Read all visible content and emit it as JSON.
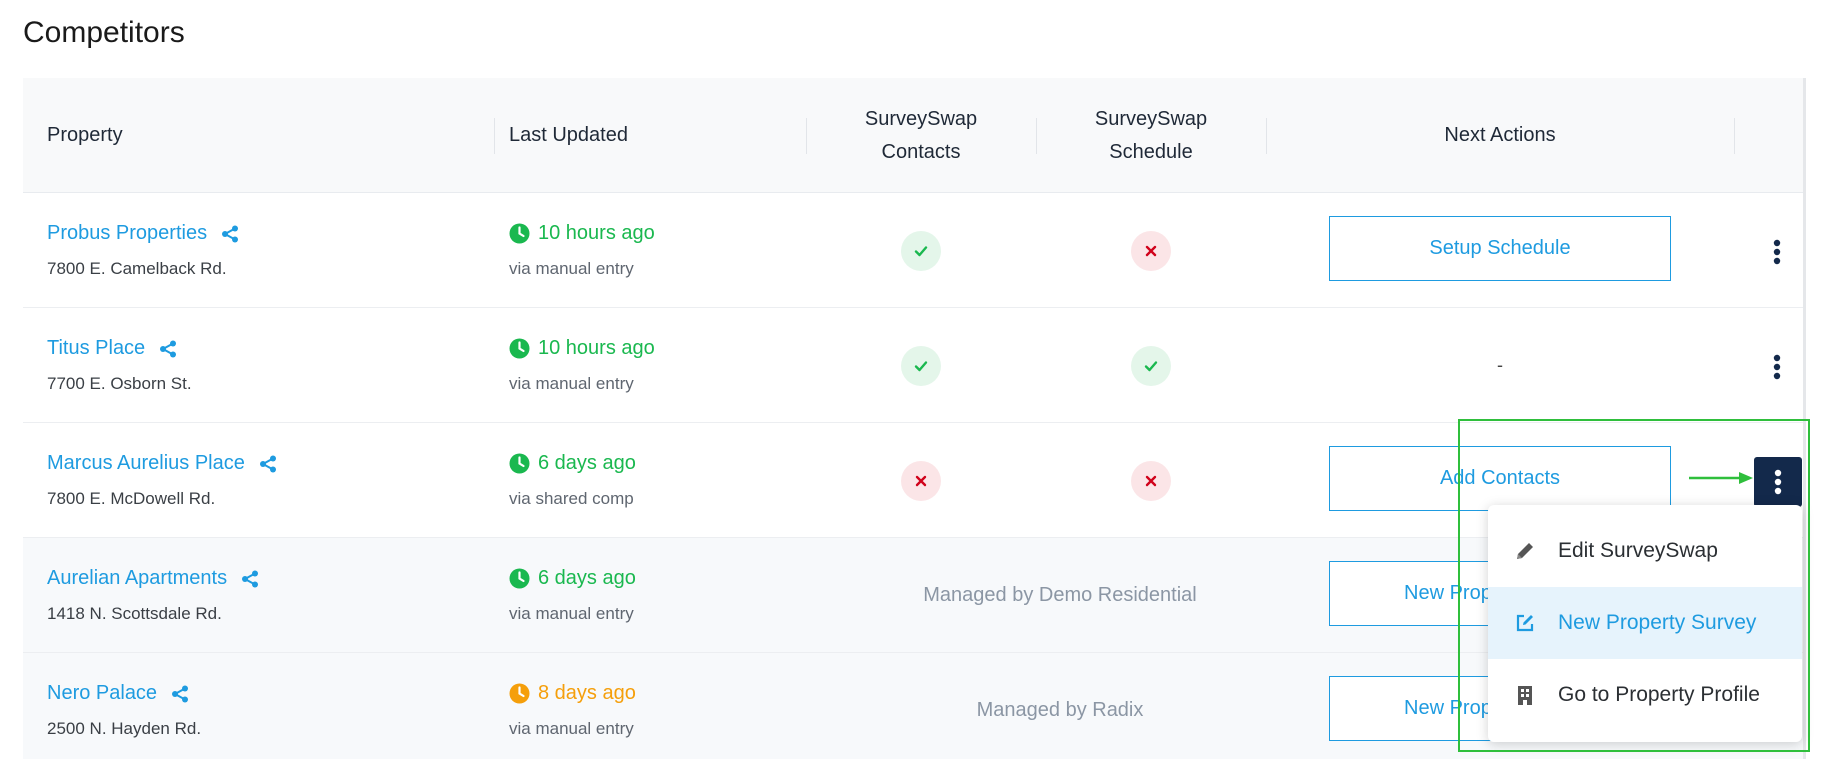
{
  "page": {
    "title": "Competitors"
  },
  "table": {
    "headers": {
      "property": "Property",
      "last_updated": "Last Updated",
      "contacts_line1": "SurveySwap",
      "contacts_line2": "Contacts",
      "schedule_line1": "SurveySwap",
      "schedule_line2": "Schedule",
      "next_actions": "Next Actions"
    },
    "rows": [
      {
        "name": "Probus Properties",
        "address": "7800 E. Camelback Rd.",
        "updated": "10 hours ago",
        "via": "via manual entry",
        "updated_status": "green",
        "contacts": "check",
        "schedule": "x",
        "action": "Setup Schedule"
      },
      {
        "name": "Titus Place",
        "address": "7700 E. Osborn St.",
        "updated": "10 hours ago",
        "via": "via manual entry",
        "updated_status": "green",
        "contacts": "check",
        "schedule": "check",
        "action": "-"
      },
      {
        "name": "Marcus Aurelius Place",
        "address": "7800 E. McDowell Rd.",
        "updated": "6 days ago",
        "via": "via shared comp",
        "updated_status": "green",
        "contacts": "x",
        "schedule": "x",
        "action": "Add Contacts"
      },
      {
        "name": "Aurelian Apartments",
        "address": "1418 N. Scottsdale Rd.",
        "updated": "6 days ago",
        "via": "via manual entry",
        "updated_status": "green",
        "managed": "Managed by Demo Residential",
        "action": "New Prop"
      },
      {
        "name": "Nero Palace",
        "address": "2500 N. Hayden Rd.",
        "updated": "8 days ago",
        "via": "via manual entry",
        "updated_status": "orange",
        "managed": "Managed by Radix",
        "action": "New Prop"
      }
    ]
  },
  "dropdown": {
    "items": [
      {
        "label": "Edit SurveySwap",
        "icon": "pencil-icon"
      },
      {
        "label": "New Property Survey",
        "icon": "edit-square-icon",
        "highlighted": true
      },
      {
        "label": "Go to Property Profile",
        "icon": "building-icon"
      }
    ]
  },
  "colors": {
    "link": "#1e9be0",
    "green": "#1ab84f",
    "orange": "#f59f0b",
    "navy": "#13294b",
    "annotation": "#2fbf3c"
  }
}
